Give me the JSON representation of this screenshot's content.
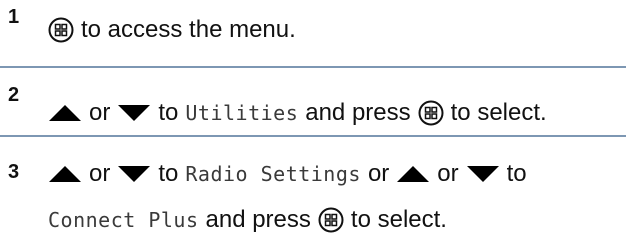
{
  "steps": [
    {
      "number": "1",
      "text_after_menu": "to access the menu."
    },
    {
      "number": "2",
      "or": "or",
      "to": "to",
      "item": "Utilities",
      "and_press": "and press",
      "to_select": "to select."
    },
    {
      "number": "3",
      "or_1": "or",
      "to_1": "to",
      "item_1": "Radio Settings",
      "or_mid": "or",
      "or_2": "or",
      "to_2": "to",
      "item_2": "Connect Plus",
      "and_press": "and press",
      "to_select": "to select."
    }
  ],
  "icons": {
    "menu_ok": "menu-ok-button-icon",
    "up": "up-arrow-icon",
    "down": "down-arrow-icon"
  },
  "colors": {
    "divider": "#7d97b3",
    "text": "#111111",
    "mono_text": "#3a3a3a"
  }
}
